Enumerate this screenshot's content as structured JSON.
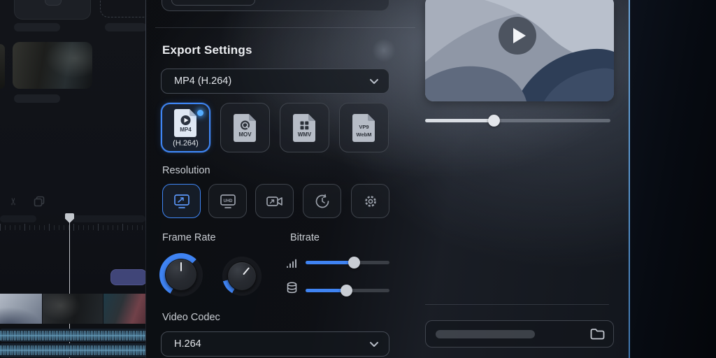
{
  "colors": {
    "accent": "#3f83f2",
    "accent_line": "#5e9ad0",
    "selected_border": "#3f86f5"
  },
  "export_panel": {
    "title": "Export Settings",
    "format_dropdown": {
      "value": "MP4 (H.264)",
      "chevron_icon": "chevron-down"
    },
    "formats": [
      {
        "icon_label": "MP4",
        "caption": "(H.264)",
        "selected": true,
        "emblem": "play-circle"
      },
      {
        "icon_label": "MOV",
        "caption": "",
        "selected": false,
        "emblem": "quicktime-logo"
      },
      {
        "icon_label": "WMV",
        "caption": "",
        "selected": false,
        "emblem": "windows-logo"
      },
      {
        "icon_label": "WebM",
        "caption": "",
        "selected": false,
        "emblem": "vp9-badge",
        "badge": "VP9"
      }
    ],
    "resolution": {
      "label": "Resolution",
      "options": [
        {
          "name": "display-hd",
          "selected": true
        },
        {
          "name": "display-uhd",
          "selected": false,
          "icon_text": "UHD"
        },
        {
          "name": "camera",
          "selected": false
        },
        {
          "name": "speed-dial",
          "selected": false
        },
        {
          "name": "gear",
          "selected": false
        }
      ]
    },
    "frame_rate": {
      "label": "Frame Rate",
      "knobs": [
        {
          "arc_deg": 195,
          "pointer_deg": 0
        },
        {
          "arc_deg": 45,
          "pointer_deg": 40
        }
      ]
    },
    "bitrate": {
      "label": "Bitrate",
      "sliders": [
        {
          "icon": "signal-bars",
          "percent": 58
        },
        {
          "icon": "database",
          "percent": 49
        }
      ]
    },
    "video_codec": {
      "label": "Video Codec",
      "value": "H.264",
      "chevron_icon": "chevron-down"
    }
  },
  "preview": {
    "play_icon": "play",
    "progress_percent": 37
  },
  "output_path": {
    "placeholder_bar": true,
    "folder_icon": "folder"
  },
  "timeline": {
    "tools": [
      {
        "icon": "cut-scissors"
      },
      {
        "icon": "duplicate"
      }
    ]
  }
}
